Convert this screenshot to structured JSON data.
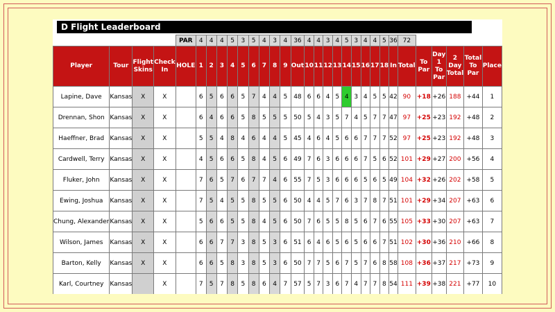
{
  "title": "D Flight Leaderboard",
  "par_row": {
    "label": "PAR",
    "holes": [
      "4",
      "4",
      "4",
      "5",
      "3",
      "5",
      "4",
      "3",
      "4"
    ],
    "out": "36",
    "back": [
      "4",
      "4",
      "3",
      "4",
      "5",
      "3",
      "4",
      "4",
      "5"
    ],
    "in": "36",
    "total": "72"
  },
  "headers": {
    "player": "Player",
    "tour": "Tour",
    "flight_skins": "Flight Skins",
    "check_in": "Check In",
    "hole": "HOLE",
    "front": [
      "1",
      "2",
      "3",
      "4",
      "5",
      "6",
      "7",
      "8",
      "9"
    ],
    "out": "Out",
    "back": [
      "10",
      "11",
      "12",
      "13",
      "14",
      "15",
      "16",
      "17",
      "18"
    ],
    "in": "In",
    "total": "Total",
    "to_par": "To Par",
    "day1_to_par": "Day 1 To Par",
    "two_day_total": "2 Day Total",
    "total_to_par": "Total To Par",
    "place": "Place"
  },
  "players": [
    {
      "name": "Lapine, Dave",
      "tour": "Kansas",
      "skins": "X",
      "checkin": "X",
      "front": [
        "6",
        "5",
        "6",
        "6",
        "5",
        "7",
        "4",
        "4",
        "5"
      ],
      "out": "48",
      "back": [
        "6",
        "6",
        "4",
        "5",
        "4",
        "3",
        "4",
        "5",
        "5"
      ],
      "in": "42",
      "total": "90",
      "to_par": "+18",
      "day1": "+26",
      "two_day": "188",
      "total_to_par": "+44",
      "place": "1"
    },
    {
      "name": "Drennan, Shon",
      "tour": "Kansas",
      "skins": "X",
      "checkin": "X",
      "front": [
        "6",
        "4",
        "6",
        "6",
        "5",
        "8",
        "5",
        "5",
        "5"
      ],
      "out": "50",
      "back": [
        "5",
        "4",
        "3",
        "5",
        "7",
        "4",
        "5",
        "7",
        "7"
      ],
      "in": "47",
      "total": "97",
      "to_par": "+25",
      "day1": "+23",
      "two_day": "192",
      "total_to_par": "+48",
      "place": "2"
    },
    {
      "name": "Haeffner, Brad",
      "tour": "Kansas",
      "skins": "X",
      "checkin": "X",
      "front": [
        "5",
        "5",
        "4",
        "8",
        "4",
        "6",
        "4",
        "4",
        "5"
      ],
      "out": "45",
      "back": [
        "4",
        "6",
        "4",
        "5",
        "6",
        "6",
        "7",
        "7",
        "7"
      ],
      "in": "52",
      "total": "97",
      "to_par": "+25",
      "day1": "+23",
      "two_day": "192",
      "total_to_par": "+48",
      "place": "3"
    },
    {
      "name": "Cardwell, Terry",
      "tour": "Kansas",
      "skins": "X",
      "checkin": "X",
      "front": [
        "4",
        "5",
        "6",
        "6",
        "5",
        "8",
        "4",
        "5",
        "6"
      ],
      "out": "49",
      "back": [
        "7",
        "6",
        "3",
        "6",
        "6",
        "6",
        "7",
        "5",
        "6"
      ],
      "in": "52",
      "total": "101",
      "to_par": "+29",
      "day1": "+27",
      "two_day": "200",
      "total_to_par": "+56",
      "place": "4"
    },
    {
      "name": "Fluker, John",
      "tour": "Kansas",
      "skins": "X",
      "checkin": "X",
      "front": [
        "7",
        "6",
        "5",
        "7",
        "6",
        "7",
        "7",
        "4",
        "6"
      ],
      "out": "55",
      "back": [
        "7",
        "5",
        "3",
        "6",
        "6",
        "6",
        "5",
        "6",
        "5"
      ],
      "in": "49",
      "total": "104",
      "to_par": "+32",
      "day1": "+26",
      "two_day": "202",
      "total_to_par": "+58",
      "place": "5"
    },
    {
      "name": "Ewing, Joshua",
      "tour": "Kansas",
      "skins": "X",
      "checkin": "X",
      "front": [
        "7",
        "5",
        "4",
        "5",
        "5",
        "8",
        "5",
        "5",
        "6"
      ],
      "out": "50",
      "back": [
        "4",
        "4",
        "5",
        "7",
        "6",
        "3",
        "7",
        "8",
        "7"
      ],
      "in": "51",
      "total": "101",
      "to_par": "+29",
      "day1": "+34",
      "two_day": "207",
      "total_to_par": "+63",
      "place": "6"
    },
    {
      "name": "Chung, Alexander",
      "tour": "Kansas",
      "skins": "X",
      "checkin": "X",
      "front": [
        "5",
        "6",
        "6",
        "5",
        "5",
        "8",
        "4",
        "5",
        "6"
      ],
      "out": "50",
      "back": [
        "7",
        "6",
        "5",
        "5",
        "8",
        "5",
        "6",
        "7",
        "6"
      ],
      "in": "55",
      "total": "105",
      "to_par": "+33",
      "day1": "+30",
      "two_day": "207",
      "total_to_par": "+63",
      "place": "7"
    },
    {
      "name": "Wilson, James",
      "tour": "Kansas",
      "skins": "X",
      "checkin": "X",
      "front": [
        "6",
        "6",
        "7",
        "7",
        "3",
        "8",
        "5",
        "3",
        "6"
      ],
      "out": "51",
      "back": [
        "6",
        "4",
        "6",
        "5",
        "6",
        "5",
        "6",
        "6",
        "7"
      ],
      "in": "51",
      "total": "102",
      "to_par": "+30",
      "day1": "+36",
      "two_day": "210",
      "total_to_par": "+66",
      "place": "8"
    },
    {
      "name": "Barton, Kelly",
      "tour": "Kansas",
      "skins": "X",
      "checkin": "X",
      "front": [
        "6",
        "6",
        "5",
        "8",
        "3",
        "8",
        "5",
        "3",
        "6"
      ],
      "out": "50",
      "back": [
        "7",
        "7",
        "5",
        "6",
        "7",
        "5",
        "7",
        "6",
        "8"
      ],
      "in": "58",
      "total": "108",
      "to_par": "+36",
      "day1": "+37",
      "two_day": "217",
      "total_to_par": "+73",
      "place": "9"
    },
    {
      "name": "Karl, Courtney",
      "tour": "Kansas",
      "skins": "",
      "checkin": "X",
      "front": [
        "7",
        "5",
        "7",
        "8",
        "5",
        "8",
        "6",
        "4",
        "7"
      ],
      "out": "57",
      "back": [
        "5",
        "7",
        "3",
        "6",
        "7",
        "4",
        "7",
        "7",
        "8"
      ],
      "in": "54",
      "total": "111",
      "to_par": "+39",
      "day1": "+38",
      "two_day": "221",
      "total_to_par": "+77",
      "place": "10"
    }
  ],
  "highlights": [
    {
      "row": 0,
      "hole": 14,
      "color": "#2ecc2e"
    }
  ]
}
